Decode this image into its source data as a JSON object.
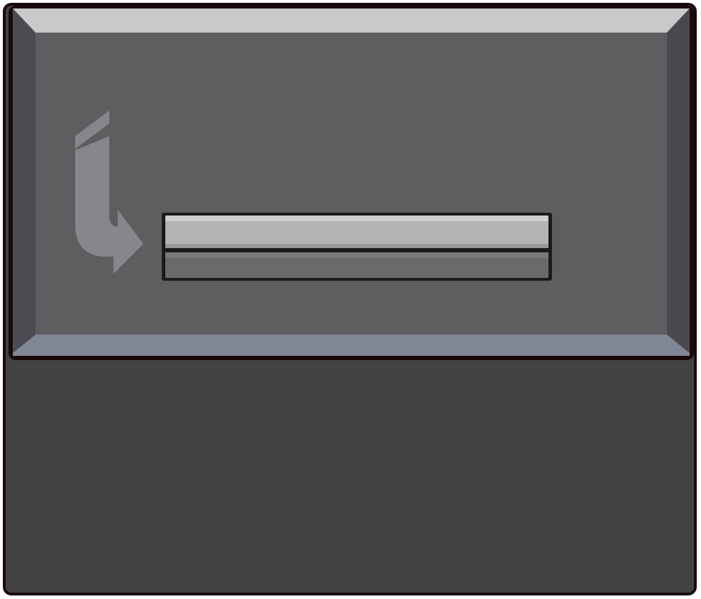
{
  "device": {
    "name": "ticket-dispenser",
    "panel_color": "#5e5e60",
    "bevel_top_color": "#c9c9c9",
    "bevel_left_color": "#4d4b52",
    "bevel_right_color": "#4a474e",
    "bevel_bottom_color": "#7f8694",
    "body_color": "#424242",
    "outline_color": "#1b0a0d",
    "arrow_color": "#86878a",
    "slot_top_color": "#b4b4b4",
    "slot_bottom_color": "#6a6a6a"
  },
  "icons": {
    "insert_arrow": "curved-down-right-arrow-icon"
  }
}
